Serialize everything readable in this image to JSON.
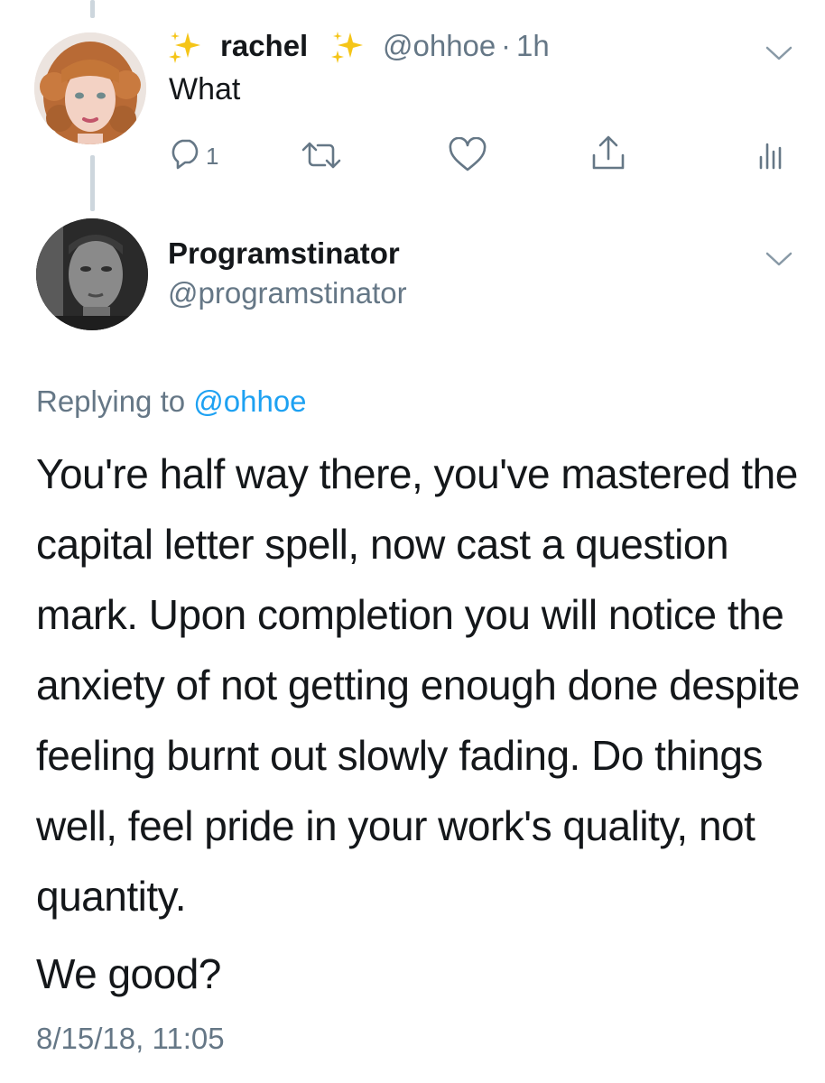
{
  "parent_tweet": {
    "display_name": "rachel",
    "handle": "@ohhoe",
    "separator": "·",
    "time": "1h",
    "text": "What",
    "reply_count": "1",
    "avatar_icon": "woman-with-red-curly-hair-photo",
    "sparkle_icon": "sparkles-emoji"
  },
  "main_tweet": {
    "display_name": "Programstinator",
    "handle": "@programstinator",
    "avatar_icon": "man-grayscale-photo",
    "replying_prefix": "Replying to ",
    "replying_handle": "@ohhoe",
    "body": "You're half way there, you've mastered the capital letter spell, now cast a question mark. Upon completion you will notice the anxiety of not getting enough done despite feeling burnt out slowly fading. Do things well, feel pride in your work's quality, not quantity.",
    "closing": "We good?",
    "timestamp": "8/15/18, 11:05"
  },
  "colors": {
    "text": "#14171a",
    "secondary": "#657786",
    "link": "#1da1f2",
    "thread_line": "#cdd6dd",
    "sparkle": "#f5c518"
  }
}
